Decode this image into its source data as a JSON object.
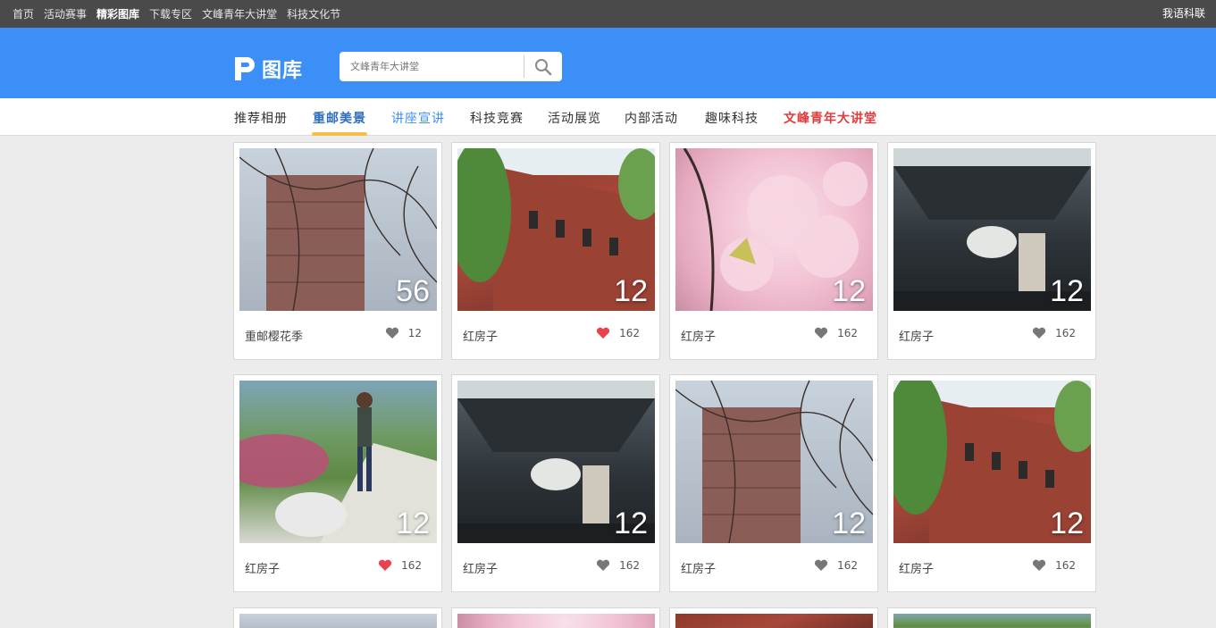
{
  "topbar": {
    "links": [
      "首页",
      "活动赛事",
      "精彩图库",
      "下载专区",
      "文峰青年大讲堂",
      "科技文化节"
    ],
    "active_index": 2,
    "right_link": "我语科联"
  },
  "header": {
    "logo_text": "图库",
    "search": {
      "placeholder": "文峰青年大讲堂"
    }
  },
  "categories": [
    {
      "label": "推荐相册"
    },
    {
      "label": "重邮美景"
    },
    {
      "label": "讲座宣讲"
    },
    {
      "label": "科技竞赛"
    },
    {
      "label": "活动展览"
    },
    {
      "label": "内部活动"
    },
    {
      "label": "趣味科技"
    },
    {
      "label": "文峰青年大讲堂"
    }
  ],
  "colors": {
    "header_blue": "#3b8ff7",
    "accent_yellow": "#f5c04a",
    "like_red": "#e8434d",
    "like_gray": "#777777"
  },
  "cards": [
    {
      "count": "56",
      "caption": "重邮樱花季",
      "likes": "12",
      "liked": false,
      "theme": "sky"
    },
    {
      "count": "12",
      "caption": "红房子",
      "likes": "162",
      "liked": true,
      "theme": "brick"
    },
    {
      "count": "12",
      "caption": "红房子",
      "likes": "162",
      "liked": false,
      "theme": "pink"
    },
    {
      "count": "12",
      "caption": "红房子",
      "likes": "162",
      "liked": false,
      "theme": "dark"
    },
    {
      "count": "12",
      "caption": "红房子",
      "likes": "162",
      "liked": true,
      "theme": "park"
    },
    {
      "count": "12",
      "caption": "红房子",
      "likes": "162",
      "liked": false,
      "theme": "dark"
    },
    {
      "count": "12",
      "caption": "红房子",
      "likes": "162",
      "liked": false,
      "theme": "sky"
    },
    {
      "count": "12",
      "caption": "红房子",
      "likes": "162",
      "liked": false,
      "theme": "brick"
    }
  ]
}
